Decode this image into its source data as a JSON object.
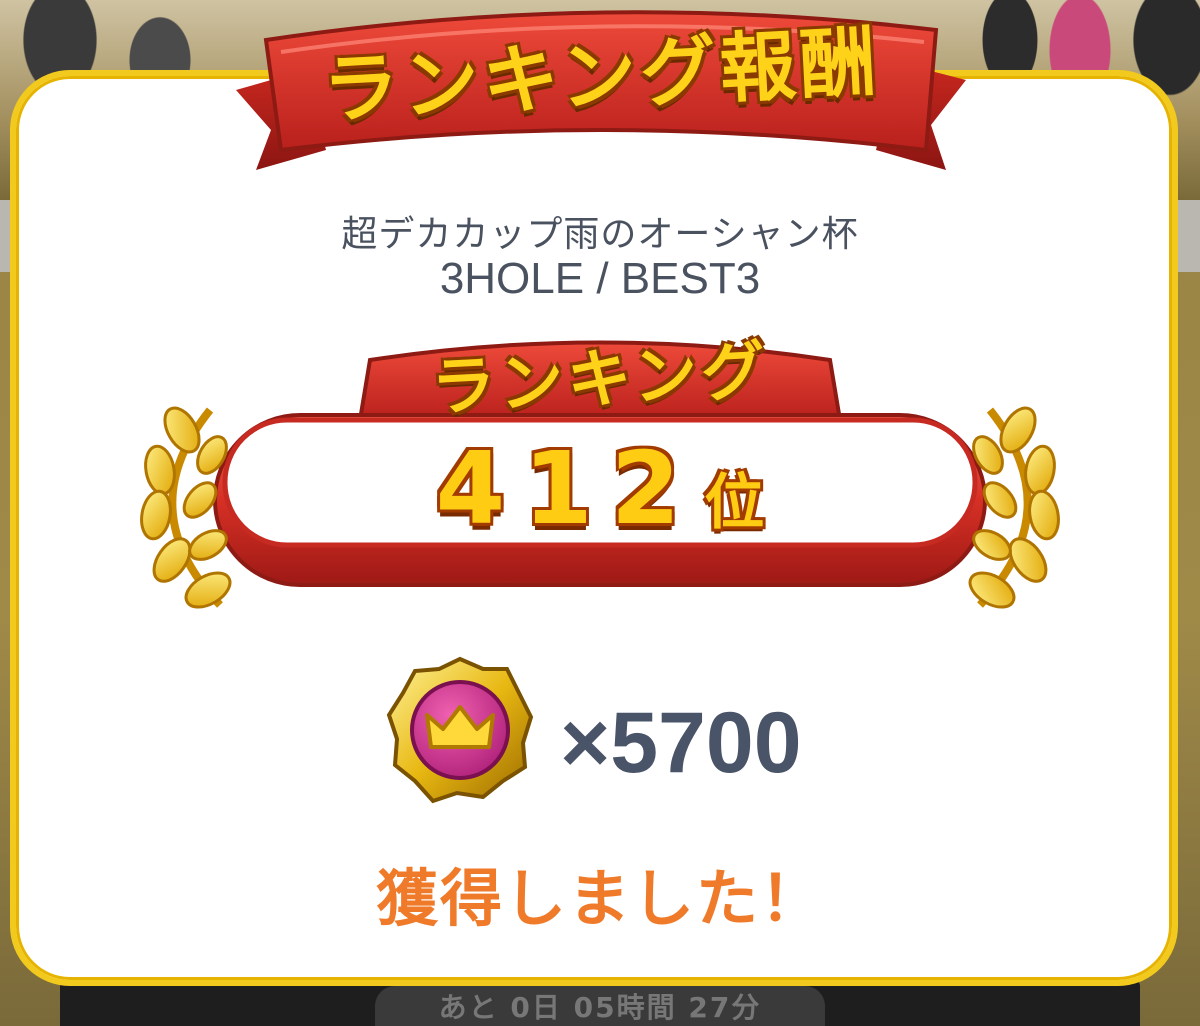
{
  "dialog": {
    "title": "ランキング報酬",
    "event_name": "超デカカップ雨のオーシャン杯",
    "event_detail": "3HOLE / BEST3",
    "ranking_label": "ランキング",
    "rank_number": "412",
    "rank_suffix": "位",
    "reward": {
      "icon": "crown-medal-icon",
      "count": "×5700"
    },
    "acquired_message": "獲得しました！"
  },
  "background": {
    "timer_text": "あと 0日 05時間 27分"
  },
  "colors": {
    "modal_border": "#f2c91d",
    "ribbon_red": "#d8322a",
    "gold_text": "#ffd21a",
    "info_text": "#4a5260",
    "acquired_orange": "#ef7a2a",
    "medal_pink": "#d6318a"
  }
}
